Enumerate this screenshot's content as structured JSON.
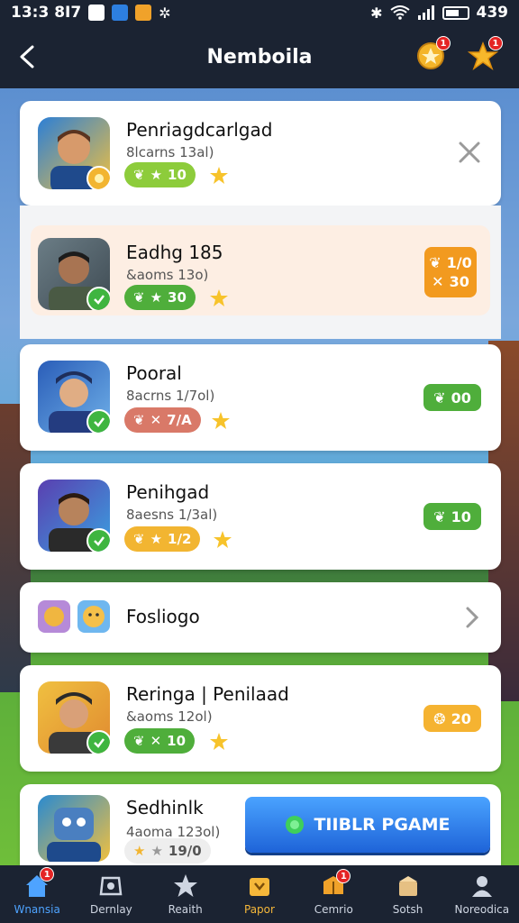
{
  "status": {
    "time": "13:3 8I7",
    "right": "439"
  },
  "header": {
    "title": "Nemboila",
    "left_badge_count": "1",
    "right_badge_count": "1"
  },
  "cards": [
    {
      "name": "Penriagdcarlgad",
      "sub": "8lcarns 13al)",
      "pill": "10",
      "pill_color": "#8dcc3b"
    },
    {
      "name": "Eadhg 185",
      "sub": "&aoms 13o)",
      "pill": "30",
      "pill_color": "#4fae3b",
      "reward_top": "1/0",
      "reward_bottom": "30"
    },
    {
      "name": "Pooral",
      "sub": "8acrns 1/7ol)",
      "pill": "7/A",
      "pill_color": "#d97968",
      "reward": "00"
    },
    {
      "name": "Penihgad",
      "sub": "8aesns 1/3al)",
      "pill": "1/2",
      "pill_color": "#f2b531",
      "reward": "10"
    },
    {
      "name": "Fosliogo"
    },
    {
      "name": "Reringa | Penilaad",
      "sub": "&aoms 12ol)",
      "pill": "10",
      "pill_color": "#4fae3b",
      "reward": "20"
    },
    {
      "name": "Sedhinlk",
      "sub": "4aoma 123ol)",
      "pill": "19/0",
      "pill_color": "#eeeeee"
    }
  ],
  "play_button": {
    "label": "TIIBLR PGAME"
  },
  "nav": [
    {
      "label": "Wnansia",
      "badge": "1"
    },
    {
      "label": "Dernlay"
    },
    {
      "label": "Reaith"
    },
    {
      "label": "Papor"
    },
    {
      "label": "Cemrio",
      "badge": "1"
    },
    {
      "label": "Sotsh"
    },
    {
      "label": "Noreodica"
    }
  ],
  "colors": {
    "accent": "#4ea3ff",
    "header_bg": "#1b2332",
    "reward_orange": "#f29a1f",
    "reward_green": "#4fae3b"
  }
}
